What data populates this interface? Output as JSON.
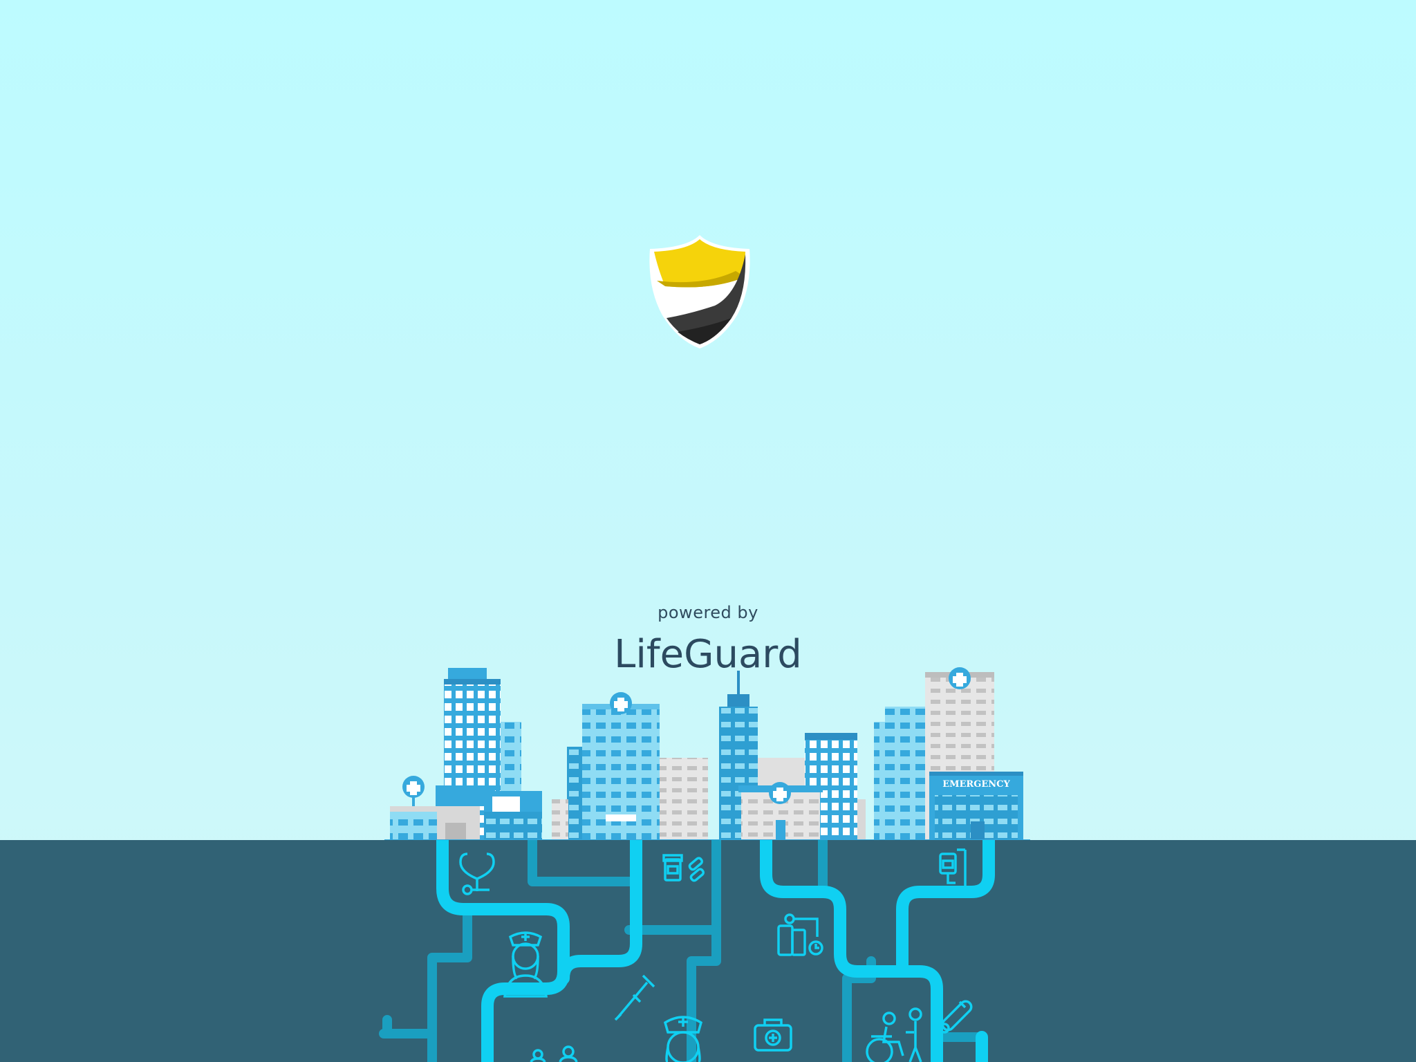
{
  "splash": {
    "powered_by": "powered by",
    "brand_name": "LifeGuard",
    "building_sign": "EMERGENCY"
  },
  "logo": {
    "icon": "shield-icon",
    "colors": {
      "top": "#f5d30b",
      "bottom": "#3a3a3a"
    }
  },
  "icons": [
    "stethoscope-icon",
    "pill-bottle-icon",
    "iv-drip-icon",
    "nurse-icon",
    "blood-pressure-monitor-icon",
    "crutch-icon",
    "first-aid-kit-icon",
    "thermometer-icon",
    "wheelchair-icon",
    "doctors-icon"
  ],
  "colors": {
    "sky": "#bdfbff",
    "ground": "#316275",
    "pipe": "#10cdf0",
    "building_blue": "#36a9dd",
    "building_light": "#8fdcf4",
    "building_gray": "#d8d8d8",
    "text": "#2c4a60"
  }
}
